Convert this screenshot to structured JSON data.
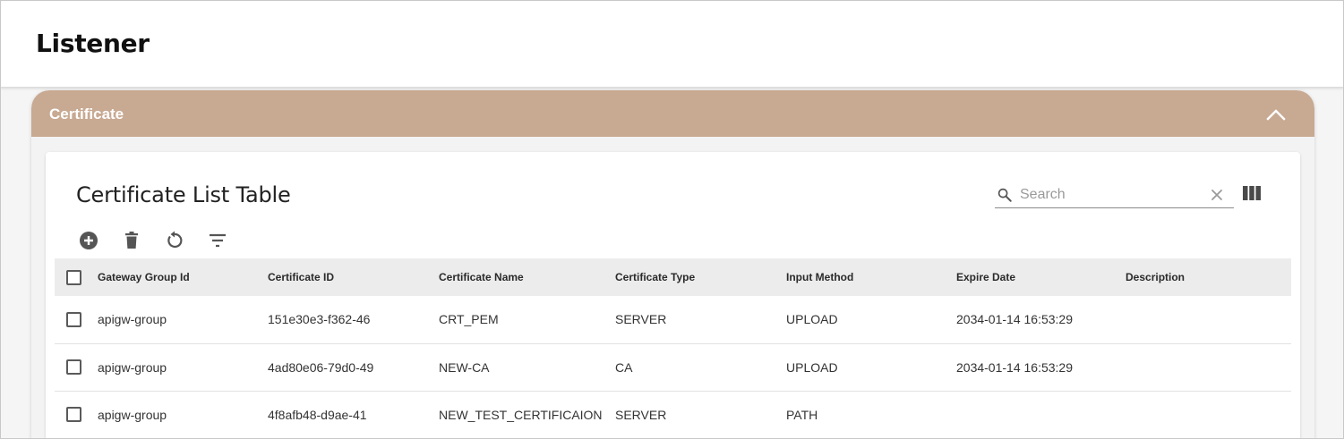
{
  "page": {
    "title": "Listener"
  },
  "panel": {
    "title": "Certificate",
    "header_color": "#c8a992"
  },
  "card": {
    "title": "Certificate List Table"
  },
  "search": {
    "placeholder": "Search",
    "value": ""
  },
  "toolbar": {
    "icons": [
      "add-circle-icon",
      "delete-icon",
      "refresh-icon",
      "filter-icon"
    ]
  },
  "table": {
    "columns": [
      "Gateway Group Id",
      "Certificate ID",
      "Certificate Name",
      "Certificate Type",
      "Input Method",
      "Expire Date",
      "Description"
    ],
    "rows": [
      [
        "apigw-group",
        "151e30e3-f362-46",
        "CRT_PEM",
        "SERVER",
        "UPLOAD",
        "2034-01-14 16:53:29",
        ""
      ],
      [
        "apigw-group",
        "4ad80e06-79d0-49",
        "NEW-CA",
        "CA",
        "UPLOAD",
        "2034-01-14 16:53:29",
        ""
      ],
      [
        "apigw-group",
        "4f8afb48-d9ae-41",
        "NEW_TEST_CERTIFICAION",
        "SERVER",
        "PATH",
        "",
        ""
      ]
    ]
  }
}
